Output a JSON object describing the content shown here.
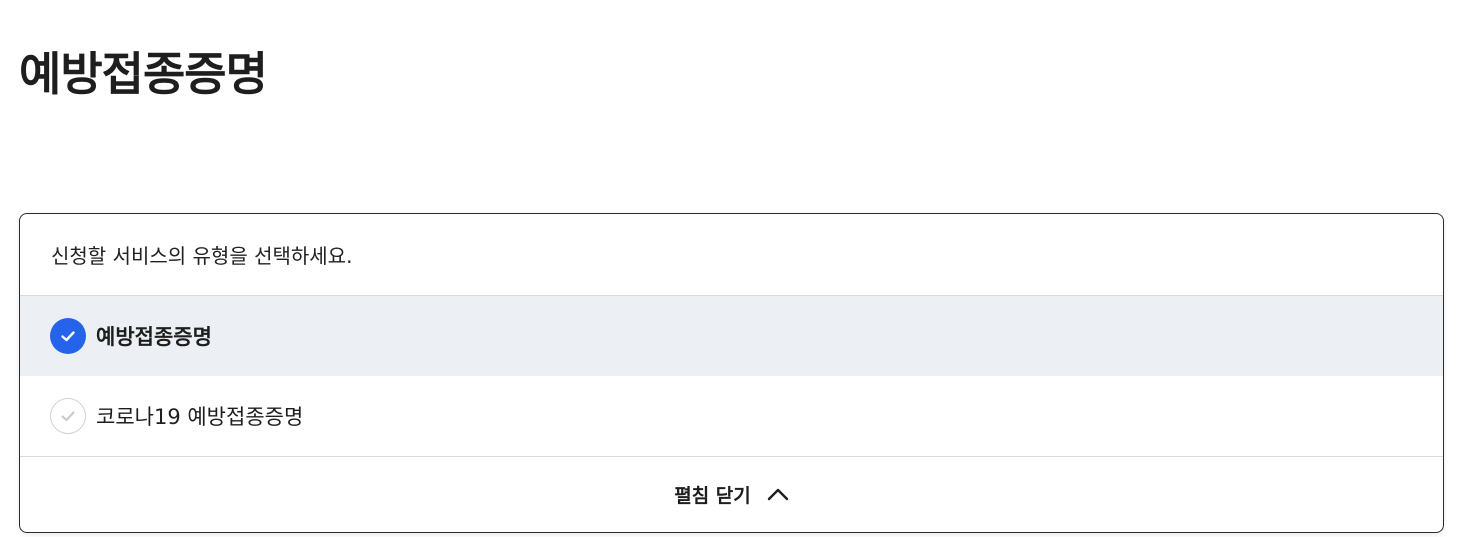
{
  "page": {
    "title": "예방접종증명"
  },
  "selector": {
    "prompt": "신청할 서비스의 유형을 선택하세요.",
    "options": [
      {
        "label": "예방접종증명",
        "selected": true
      },
      {
        "label": "코로나19 예방접종증명",
        "selected": false
      }
    ],
    "collapse_label": "펼침 닫기",
    "collapse_icon": "chevron-up-icon"
  },
  "colors": {
    "accent": "#2563eb",
    "selected_row_bg": "#eceff4",
    "border": "#2b2b2b"
  }
}
